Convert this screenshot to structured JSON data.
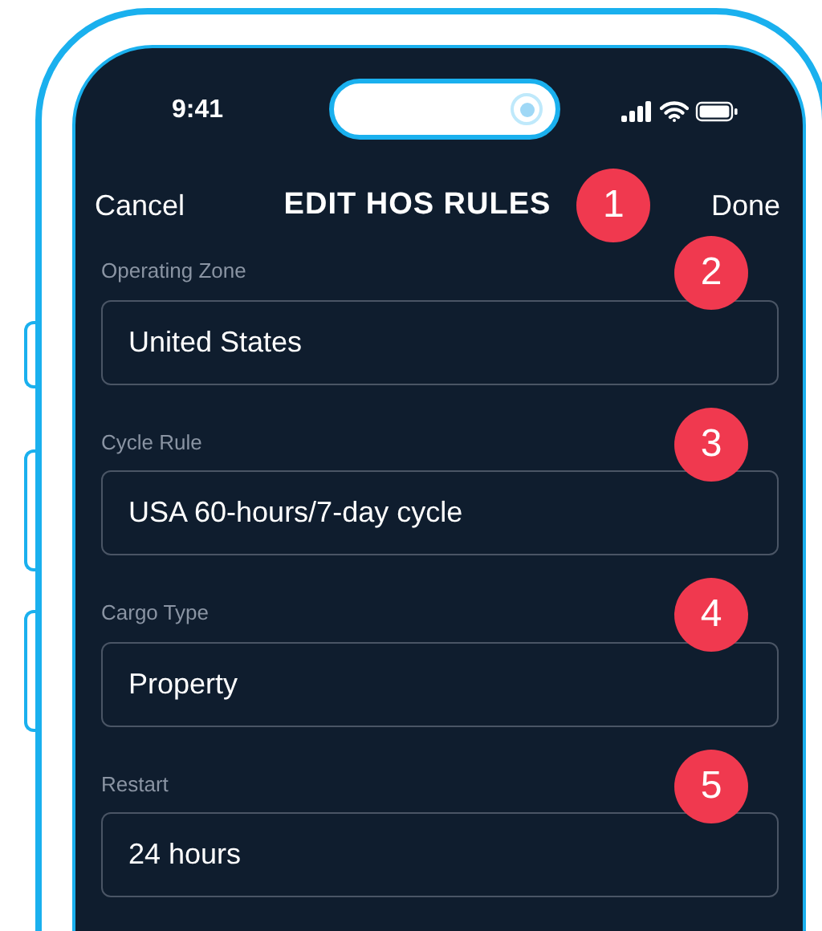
{
  "status_bar": {
    "time": "9:41"
  },
  "nav": {
    "cancel": "Cancel",
    "title": "EDIT HOS RULES",
    "callout": "1",
    "done": "Done"
  },
  "fields": [
    {
      "label": "Operating Zone",
      "value": "United States",
      "callout": "2"
    },
    {
      "label": "Cycle Rule",
      "value": "USA 60-hours/7-day cycle",
      "callout": "3"
    },
    {
      "label": "Cargo Type",
      "value": "Property",
      "callout": "4"
    },
    {
      "label": "Restart",
      "value": "24 hours",
      "callout": "5"
    }
  ]
}
